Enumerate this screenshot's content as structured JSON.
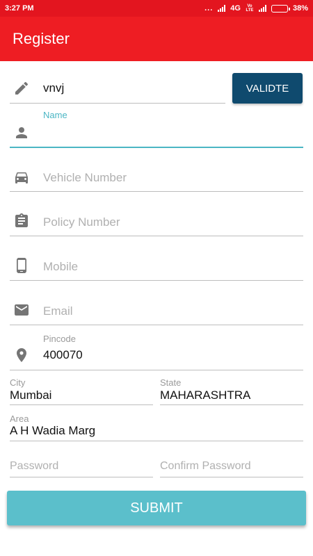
{
  "status_bar": {
    "time": "3:27 PM",
    "dots": "...",
    "network": "4G",
    "volte_top": "Vo",
    "volte_bottom": "LTE",
    "battery": "38%",
    "battery_level": 0.38
  },
  "app_bar": {
    "title": "Register"
  },
  "validate_field": {
    "value": "vnvj",
    "button_label": "VALIDTE",
    "icon": "pencil-icon"
  },
  "name_field": {
    "label": "Name",
    "value": "",
    "icon": "person-icon"
  },
  "vehicle_field": {
    "placeholder": "Vehicle Number",
    "icon": "car-icon"
  },
  "policy_field": {
    "placeholder": "Policy Number",
    "icon": "clipboard-icon"
  },
  "mobile_field": {
    "placeholder": "Mobile",
    "icon": "phone-icon"
  },
  "email_field": {
    "placeholder": "Email",
    "icon": "mail-icon"
  },
  "pincode_field": {
    "label": "Pincode",
    "value": "400070",
    "icon": "location-pin-icon"
  },
  "city_field": {
    "label": "City",
    "value": "Mumbai"
  },
  "state_field": {
    "label": "State",
    "value": "MAHARASHTRA"
  },
  "area_field": {
    "label": "Area",
    "value": "A H Wadia Marg"
  },
  "password_field": {
    "placeholder": "Password"
  },
  "confirm_password_field": {
    "placeholder": "Confirm Password"
  },
  "submit": {
    "label": "SUBMIT"
  },
  "colors": {
    "status_bar": "#e3151f",
    "app_bar": "#ee1d23",
    "validate_button": "#0f4a6e",
    "accent": "#4bb6c4",
    "submit_button": "#5bbfcb",
    "icon": "#757575"
  }
}
